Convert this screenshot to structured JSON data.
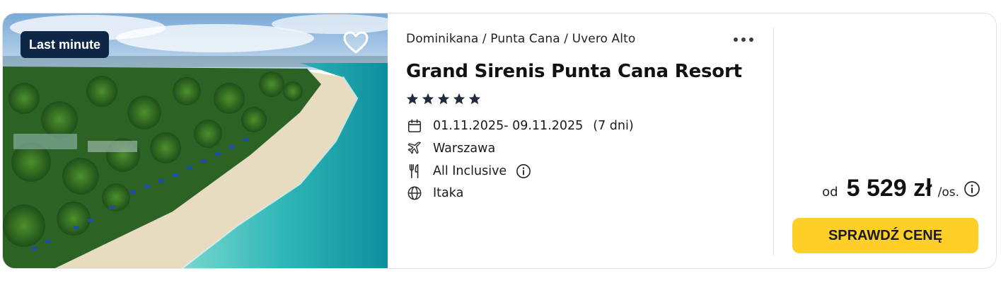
{
  "offer": {
    "badge": "Last minute",
    "breadcrumb": "Dominikana / Punta Cana / Uvero Alto",
    "hotel_name": "Grand Sirenis Punta Cana Resort",
    "stars": 5,
    "dates": "01.11.2025- 09.11.2025",
    "duration": "(7 dni)",
    "departure_city": "Warszawa",
    "board": "All Inclusive",
    "operator": "Itaka"
  },
  "price": {
    "prefix": "od",
    "amount": "5 529 zł",
    "per": "/os.",
    "cta": "SPRAWDŹ CENĘ"
  },
  "icons": {
    "favorite": "heart-outline-icon",
    "menu": "more-dots-icon",
    "star": "star-icon",
    "calendar": "calendar-icon",
    "plane": "plane-icon",
    "board": "cutlery-icon",
    "info": "info-icon",
    "globe": "globe-icon"
  },
  "colors": {
    "badge_bg": "#0f2746",
    "cta_bg": "#fdcf27",
    "star": "#1f2b3d"
  }
}
